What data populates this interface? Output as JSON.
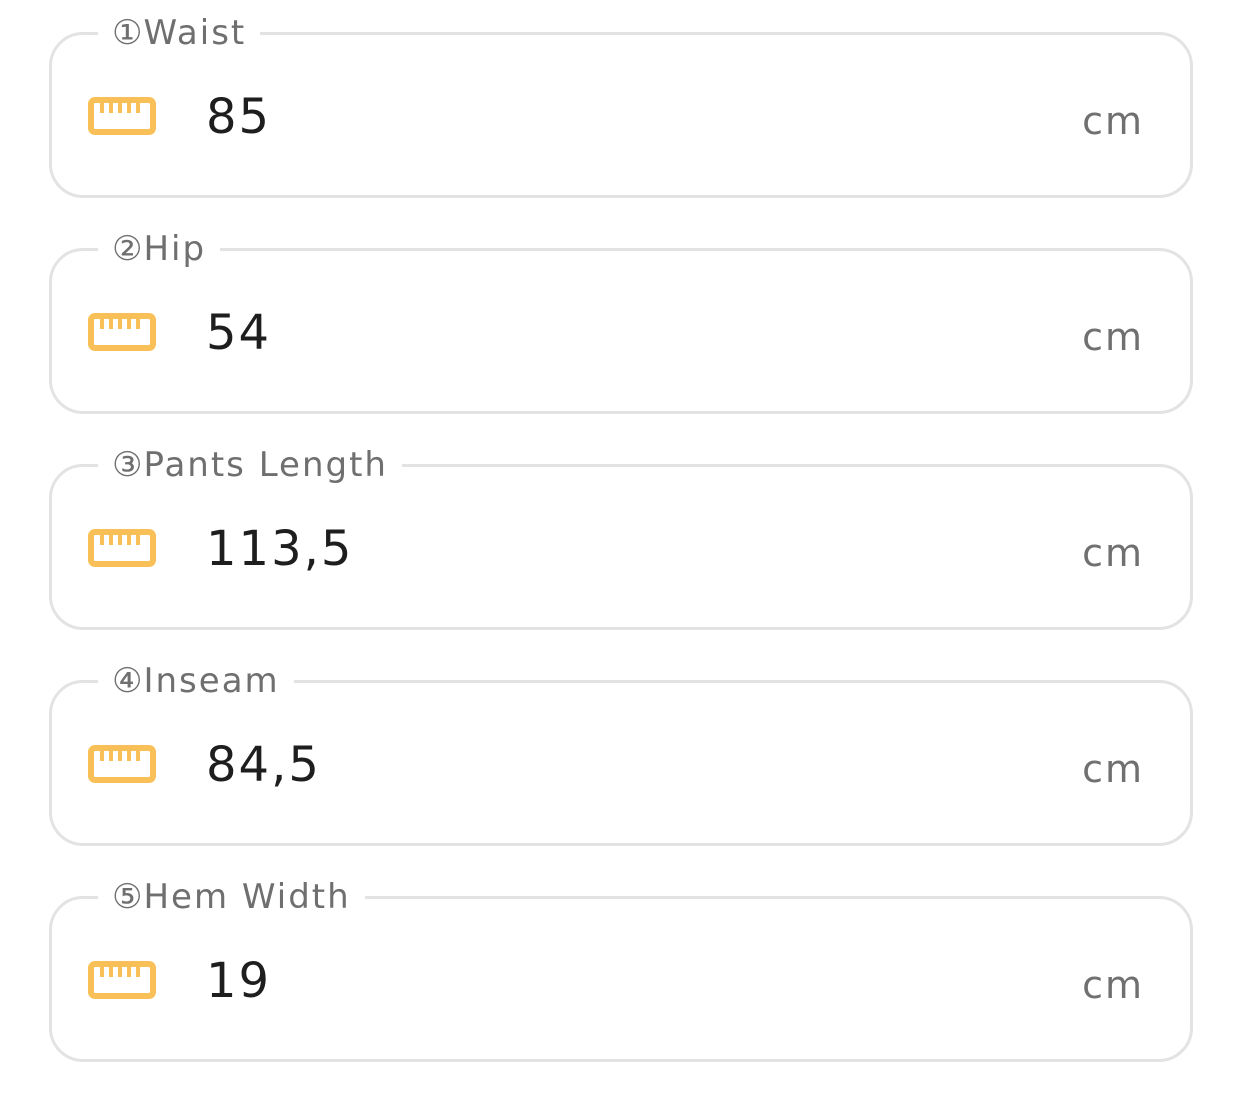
{
  "colors": {
    "accent": "#f8c056",
    "border": "#e3e3e3",
    "label": "#6f6f6f",
    "value": "#1e1e1e",
    "unit": "#707070"
  },
  "fields": [
    {
      "number": "①",
      "label": "Waist",
      "value": "85",
      "unit": "cm",
      "icon": "ruler-icon"
    },
    {
      "number": "②",
      "label": "Hip",
      "value": "54",
      "unit": "cm",
      "icon": "ruler-icon"
    },
    {
      "number": "③",
      "label": "Pants Length",
      "value": "113,5",
      "unit": "cm",
      "icon": "ruler-icon"
    },
    {
      "number": "④",
      "label": "Inseam",
      "value": "84,5",
      "unit": "cm",
      "icon": "ruler-icon"
    },
    {
      "number": "⑤",
      "label": "Hem Width",
      "value": "19",
      "unit": "cm",
      "icon": "ruler-icon"
    }
  ]
}
